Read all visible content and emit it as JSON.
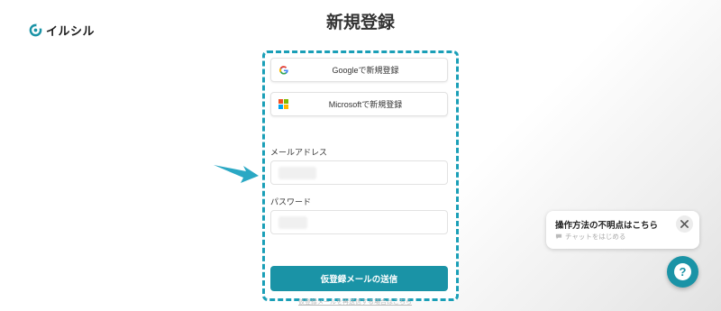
{
  "logo": {
    "text": "イルシル"
  },
  "page": {
    "title": "新規登録"
  },
  "signup": {
    "google_label": "Googleで新規登録",
    "microsoft_label": "Microsoftで新規登録",
    "email_label": "メールアドレス",
    "email_value": "",
    "password_label": "パスワード",
    "password_value": "",
    "submit_label": "仮登録メールの送信",
    "resend_link": "仮登録メールを再送信する場合はこちら"
  },
  "chat": {
    "title": "操作方法の不明点はこちら",
    "subtitle": "チャットをはじめる"
  },
  "help": {
    "label": "?"
  },
  "colors": {
    "accent": "#1a93a6",
    "highlight_border": "#1a9fb7",
    "arrow": "#2aa8c4"
  },
  "icons": [
    "logo-icon",
    "google-icon",
    "microsoft-icon",
    "arrow-pointer-icon",
    "chat-bubble-icon",
    "close-icon",
    "question-icon"
  ]
}
